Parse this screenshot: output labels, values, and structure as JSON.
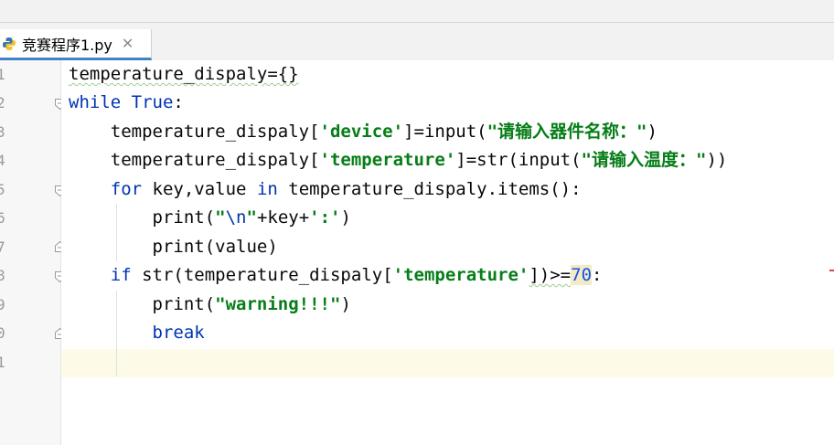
{
  "tab": {
    "label": "竞赛程序1.py",
    "close": "✕",
    "icon": "python-file-icon"
  },
  "colors": {
    "keyword": "#0033b3",
    "string": "#067d17",
    "number": "#1750eb",
    "current_line": "#fdfbe7",
    "tab_underline": "#4083c9"
  },
  "line_numbers": [
    "1",
    "2",
    "3",
    "4",
    "5",
    "6",
    "7",
    "8",
    "9",
    "0",
    "1"
  ],
  "code": {
    "l1": {
      "a": "temperature_dispaly={}"
    },
    "l2": {
      "kw1": "while",
      "sp": " ",
      "kw2": "True",
      "rest": ":"
    },
    "l3": {
      "a": "    temperature_dispaly[",
      "s1": "'device'",
      "b": "]=input(",
      "s2": "\"请输入器件名称：\"",
      "c": ")"
    },
    "l4": {
      "a": "    temperature_dispaly[",
      "s1": "'temperature'",
      "b": "]=str(input(",
      "s2": "\"请输入温度：\"",
      "c": "))"
    },
    "l5": {
      "ind": "    ",
      "kw1": "for",
      "a": " key,value ",
      "kw2": "in",
      "b": " temperature_dispaly.items():"
    },
    "l6": {
      "ind": "        ",
      "a": "print(",
      "s1": "\"",
      "esc": "\\n",
      "s1b": "\"",
      "b": "+key+",
      "s2": "':'",
      "c": ")"
    },
    "l7": {
      "a": "        print(value)"
    },
    "l8": {
      "ind": "    ",
      "kw1": "if",
      "a": " str(temperature_dispaly[",
      "s1": "'temperature'",
      "b": "])>=",
      "n": "70",
      "c": ":"
    },
    "l9": {
      "ind": "        ",
      "a": "print(",
      "s1": "\"warning!!!\"",
      "b": ")"
    },
    "l10": {
      "ind": "        ",
      "kw1": "break"
    }
  }
}
